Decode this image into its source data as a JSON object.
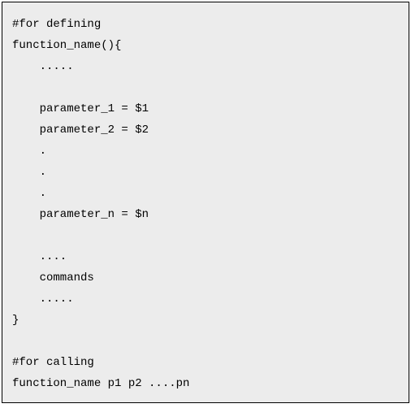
{
  "code": {
    "lines": [
      "#for defining",
      "function_name(){",
      "    .....",
      "",
      "    parameter_1 = $1",
      "    parameter_2 = $2",
      "    .",
      "    .",
      "    .",
      "    parameter_n = $n",
      "",
      "    ....",
      "    commands",
      "    .....",
      "}",
      "",
      "#for calling",
      "function_name p1 p2 ....pn"
    ]
  }
}
